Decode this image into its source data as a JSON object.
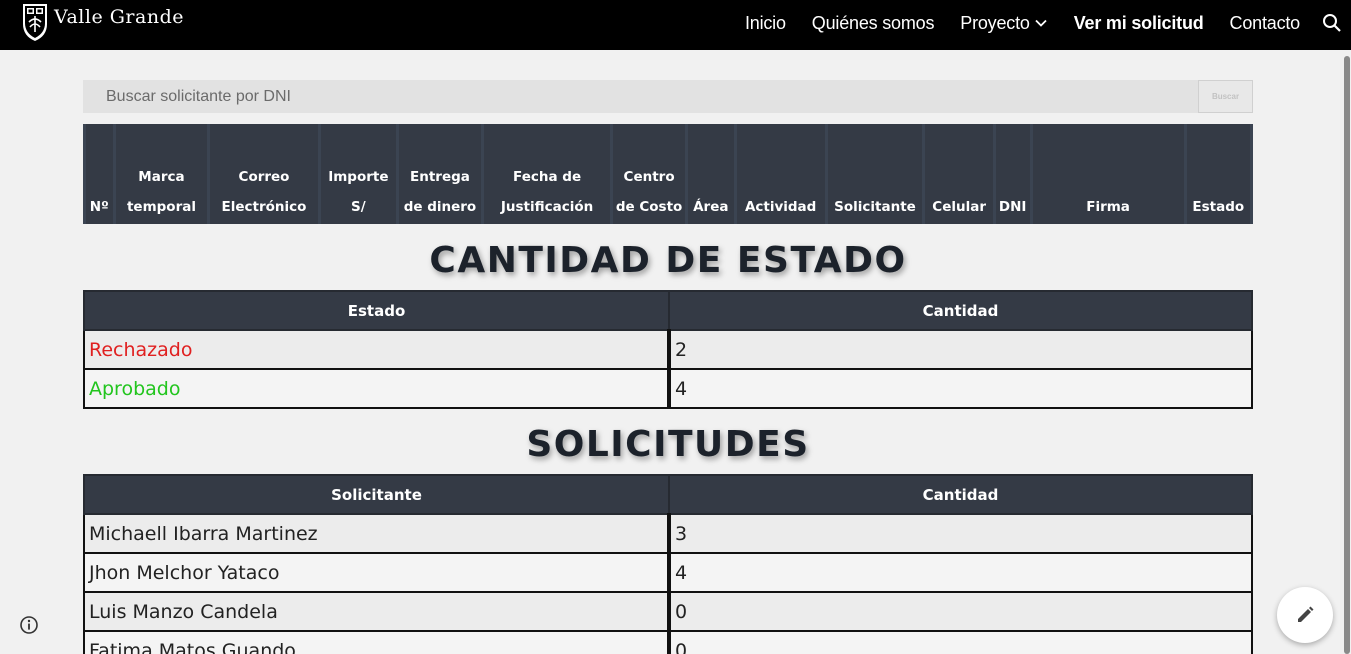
{
  "brand": {
    "name": "Valle Grande"
  },
  "nav": {
    "items": [
      {
        "label": "Inicio",
        "active": false
      },
      {
        "label": "Quiénes somos",
        "active": false
      },
      {
        "label": "Proyecto",
        "active": false
      },
      {
        "label": "Ver mi solicitud",
        "active": true
      },
      {
        "label": "Contacto",
        "active": false
      }
    ]
  },
  "search": {
    "placeholder": "Buscar solicitante por DNI",
    "value": "",
    "button_label": "Buscar"
  },
  "main_table": {
    "headers": [
      "Nº",
      "Marca temporal",
      "Correo Electrónico",
      "Importe S/",
      "Entrega de dinero",
      "Fecha de Justificación",
      "Centro de Costo",
      "Área",
      "Actividad",
      "Solicitante",
      "Celular",
      "DNI",
      "Firma",
      "Estado"
    ]
  },
  "estado_section": {
    "title": "CANTIDAD DE ESTADO",
    "headers": [
      "Estado",
      "Cantidad"
    ],
    "rows": [
      {
        "label": "Rechazado",
        "value": "2",
        "color": "#e02020"
      },
      {
        "label": "Aprobado",
        "value": "4",
        "color": "#22c51e"
      }
    ]
  },
  "solicitudes_section": {
    "title": "SOLICITUDES",
    "headers": [
      "Solicitante",
      "Cantidad"
    ],
    "rows": [
      {
        "label": "Michaell Ibarra Martinez",
        "value": "3"
      },
      {
        "label": "Jhon Melchor Yataco",
        "value": "4"
      },
      {
        "label": "Luis Manzo Candela",
        "value": "0"
      },
      {
        "label": "Fatima Matos Guando",
        "value": "0"
      }
    ]
  },
  "icons": {
    "search": "search-icon",
    "edit": "pencil-icon",
    "info": "info-icon",
    "dropdown": "chevron-down-icon"
  },
  "colors": {
    "nav_bg": "#000000",
    "table_header": "#343a45",
    "page_bg": "#f1f1f1"
  }
}
